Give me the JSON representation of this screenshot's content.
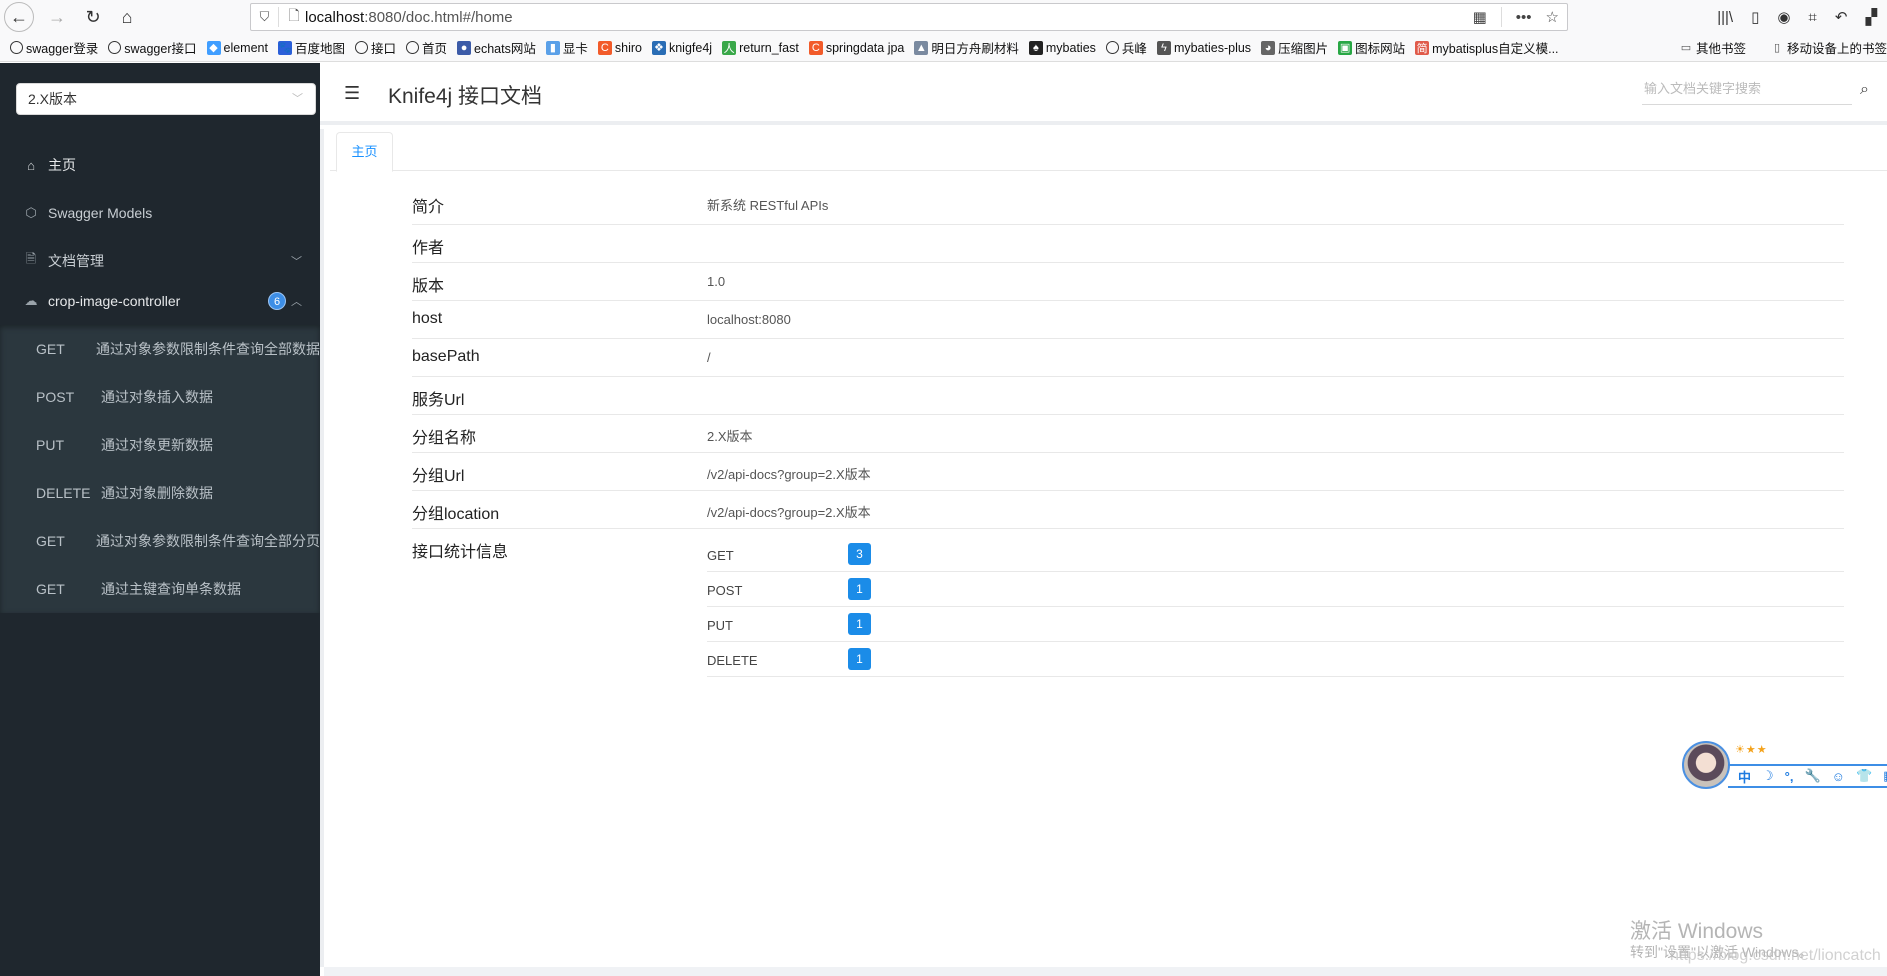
{
  "browser": {
    "url_host": "localhost",
    "url_rest": ":8080/doc.html#/home",
    "nav_icons": [
      "back-icon",
      "forward-icon",
      "reload-icon",
      "home-icon"
    ],
    "bookmarks": [
      {
        "label": "swagger登录",
        "icon": "globe-icon"
      },
      {
        "label": "swagger接口",
        "icon": "globe-icon"
      },
      {
        "label": "element",
        "icon": "element-icon"
      },
      {
        "label": "百度地图",
        "icon": "baidu-map-icon"
      },
      {
        "label": "接口",
        "icon": "globe-icon"
      },
      {
        "label": "首页",
        "icon": "globe-icon"
      },
      {
        "label": "echats网站",
        "icon": "echarts-icon"
      },
      {
        "label": "显卡",
        "icon": "gpu-icon"
      },
      {
        "label": "shiro",
        "icon": "c-icon"
      },
      {
        "label": "knigfe4j",
        "icon": "knife4j-icon"
      },
      {
        "label": "return_fast",
        "icon": "person-icon"
      },
      {
        "label": "springdata jpa",
        "icon": "c-icon"
      },
      {
        "label": "明日方舟刷材料",
        "icon": "arknights-icon"
      },
      {
        "label": "mybaties",
        "icon": "mybatis-bird-icon"
      },
      {
        "label": "兵峰",
        "icon": "globe-icon"
      },
      {
        "label": "mybaties-plus",
        "icon": "mybatis-plus-icon"
      },
      {
        "label": "压缩图片",
        "icon": "panda-icon"
      },
      {
        "label": "图标网站",
        "icon": "iconfont-icon"
      },
      {
        "label": "mybatisplus自定义模...",
        "icon": "jian-icon"
      }
    ],
    "bookmarks_right": [
      {
        "label": "其他书签",
        "icon": "folder-icon"
      },
      {
        "label": "移动设备上的书签",
        "icon": "mobile-icon"
      }
    ]
  },
  "sidebar": {
    "group_select": "2.X版本",
    "items": [
      {
        "label": "主页",
        "icon": "home-icon"
      },
      {
        "label": "Swagger Models",
        "icon": "cube-icon"
      },
      {
        "label": "文档管理",
        "icon": "doc-settings-icon"
      },
      {
        "label": "crop-image-controller",
        "icon": "cloud-icon",
        "badge": "6"
      }
    ],
    "apis": [
      {
        "method": "GET",
        "desc": "通过对象参数限制条件查询全部数据"
      },
      {
        "method": "POST",
        "desc": "通过对象插入数据"
      },
      {
        "method": "PUT",
        "desc": "通过对象更新数据"
      },
      {
        "method": "DELETE",
        "desc": "通过对象删除数据"
      },
      {
        "method": "GET",
        "desc": "通过对象参数限制条件查询全部分页"
      },
      {
        "method": "GET",
        "desc": "通过主键查询单条数据"
      }
    ]
  },
  "header": {
    "title": "Knife4j 接口文档",
    "search_placeholder": "输入文档关键字搜索"
  },
  "tabs": [
    {
      "label": "主页"
    }
  ],
  "info": [
    {
      "key": "简介",
      "value": "新系统 RESTful APIs"
    },
    {
      "key": "作者",
      "value": ""
    },
    {
      "key": "版本",
      "value": "1.0"
    },
    {
      "key": "host",
      "value": "localhost:8080"
    },
    {
      "key": "basePath",
      "value": "/"
    },
    {
      "key": "服务Url",
      "value": ""
    },
    {
      "key": "分组名称",
      "value": "2.X版本"
    },
    {
      "key": "分组Url",
      "value": "/v2/api-docs?group=2.X版本"
    },
    {
      "key": "分组location",
      "value": "/v2/api-docs?group=2.X版本"
    }
  ],
  "stats": {
    "label": "接口统计信息",
    "rows": [
      {
        "method": "GET",
        "count": "3"
      },
      {
        "method": "POST",
        "count": "1"
      },
      {
        "method": "PUT",
        "count": "1"
      },
      {
        "method": "DELETE",
        "count": "1"
      }
    ]
  },
  "ime_widget": {
    "stars": "☀★★",
    "buttons": [
      "中",
      "☽",
      "°,",
      "🔧",
      "☺",
      "👕",
      "▦"
    ]
  },
  "watermark": {
    "line1": "激活 Windows",
    "line2": "转到\"设置\"以激活 Windows。",
    "csdn": "https://blog.csdn.net/lioncatch"
  },
  "colors": {
    "accent": "#1890ff",
    "badge": "#1b8ce8",
    "sidebar_bg": "#1f272e",
    "submenu_bg": "#2b373e"
  }
}
